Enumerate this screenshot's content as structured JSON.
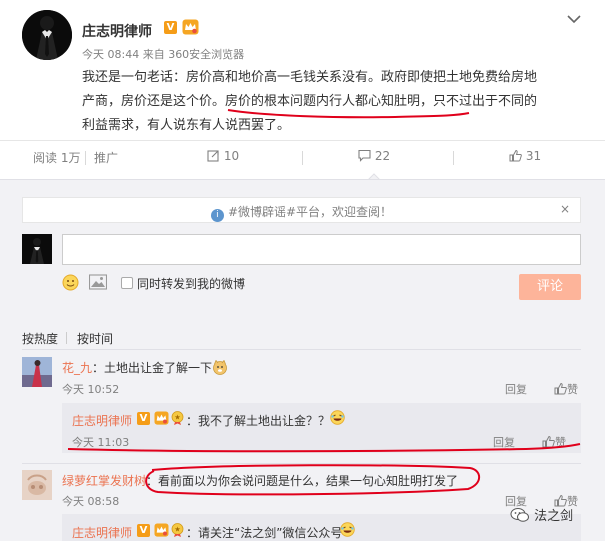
{
  "post": {
    "author": "庄志明律师",
    "meta": "今天 08:44 来自 360安全浏览器",
    "text": "我还是一句老话：房价高和地价高一毛钱关系没有。政府即使把土地免费给房地产商，房价还是这个价。房价的根本问题内行人都心知肚明，只不过出于不同的利益需求，有人说东有人说西罢了。",
    "text_line1": "我还是一句老话：房价高和地价高一毛钱关系没有。政府即使把土地免费给房地",
    "text_line2": "产商，房价还是这个价。房价的根本问题内行人都心知肚明，只不过出于不同的",
    "text_line3": "利益需求，有人说东有人说西罢了。"
  },
  "actions": {
    "read": "阅读 1万",
    "promote": "推广",
    "forward_count": "10",
    "comment_count": "22",
    "like_count": "31"
  },
  "notice": {
    "text": "#微博辟谣#平台，欢迎查阅！",
    "close": "×"
  },
  "composer": {
    "input_value": "",
    "forward_label": "同时转发到我的微博",
    "submit_label": "评论"
  },
  "sort_tabs": {
    "hot": "按热度",
    "time": "按时间"
  },
  "comments": [
    {
      "user": "花_九",
      "text": "：土地出让金了解一下",
      "time": "今天 10:52",
      "reply": "回复",
      "like": "赞",
      "reply_block": {
        "user": "庄志明律师",
        "text": "：我不了解土地出让金？？",
        "time": "今天 11:03",
        "reply": "回复",
        "like": "赞"
      }
    },
    {
      "user": "绿萝红掌发财树",
      "text": "：看前面以为你会说问题是什么，结果一句心知肚明打发了",
      "time": "今天 08:58",
      "reply": "回复",
      "like": "赞",
      "reply_block": {
        "user": "庄志明律师",
        "text": "：请关注“法之剑”微信公众号",
        "time": ""
      }
    }
  ],
  "watermark": "法之剑",
  "colors": {
    "link": "#eb7350",
    "submit": "#fdb49a",
    "annotation": "#e0001b",
    "panel": "#f2f2f5",
    "notice_icon": "#5d95ce"
  },
  "icons": {
    "verified_badge": "v-badge-icon",
    "member_badge": "crown-icon",
    "more": "chevron-down-icon",
    "forward": "forward-icon",
    "comment": "comment-icon",
    "like": "thumb-up-icon",
    "notice": "info-icon",
    "emoji": "smiley-icon",
    "image": "image-icon"
  }
}
